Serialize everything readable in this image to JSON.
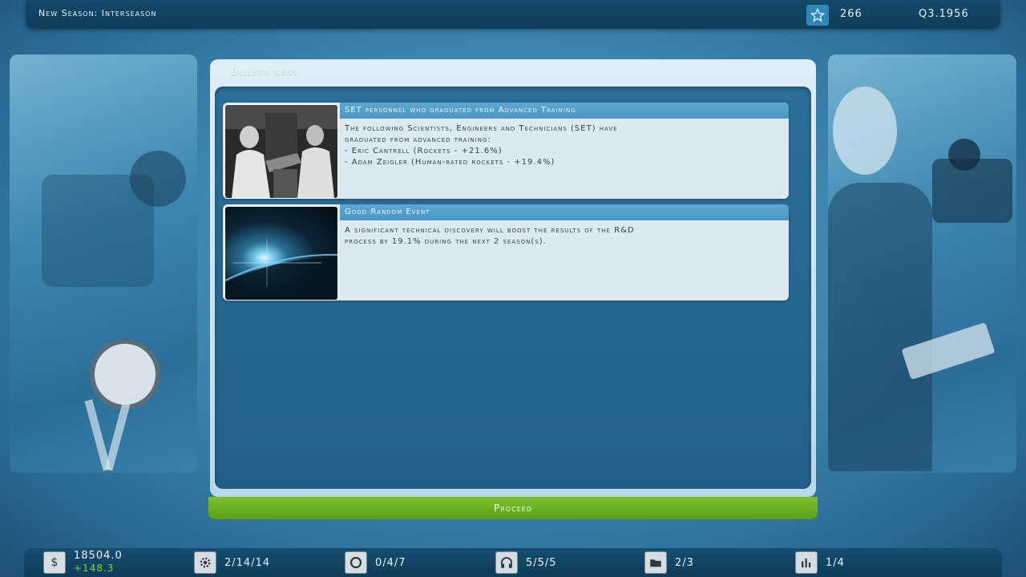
{
  "top_bar": {
    "season_text": "New Season: Interseason",
    "reputation": "266",
    "date": "Q3.1956",
    "star_icon": "star-icon"
  },
  "bulletin": {
    "title": "Bulletin News",
    "items": [
      {
        "title": "SET personnel who graduated from Advanced Training",
        "lines": [
          "The following Scientists, Engineers and Technicians (SET) have",
          "graduated from advanced training:",
          "- Eric Cantrell (Rockets - +21.6%)",
          "- Adam Zeigler (Human-rated rockets - +19.4%)"
        ],
        "thumb": "scientists-photo"
      },
      {
        "title": "Good Random Event",
        "lines": [
          "A significant technical discovery will boost the results of the R&D",
          "process by 19.1% during the next 2 season(s)."
        ],
        "thumb": "sunrise-earth-photo"
      }
    ]
  },
  "proceed_label": "Proceed",
  "bottom_bar": {
    "money": "18504.0",
    "money_delta": "+148.3",
    "facilities": "2/14/14",
    "programs": "0/4/7",
    "staff": "5/5/5",
    "files": "2/3",
    "stats": "1/4"
  },
  "colors": {
    "accent_green": "#6cb323",
    "panel_blue": "#2c6f98",
    "title_blue": "#5fa7d1"
  }
}
